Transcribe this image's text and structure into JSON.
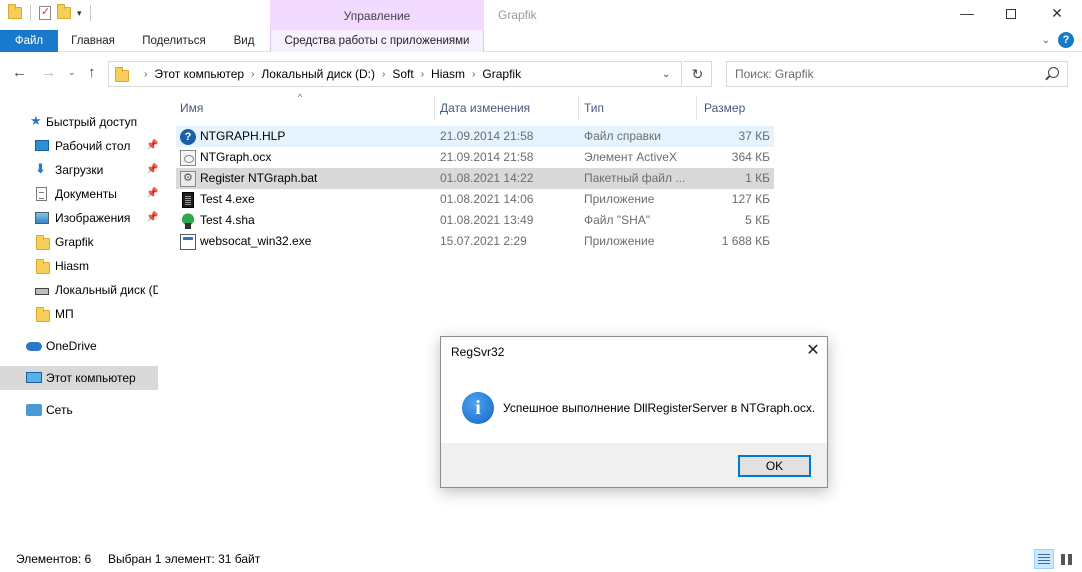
{
  "window": {
    "title": "Grapfik",
    "context_group": "Управление",
    "controls": {
      "minimize": "—",
      "close": "✕"
    }
  },
  "ribbon": {
    "tabs": [
      {
        "label": "Файл"
      },
      {
        "label": "Главная"
      },
      {
        "label": "Поделиться"
      },
      {
        "label": "Вид"
      },
      {
        "label": "Средства работы с приложениями"
      }
    ],
    "help": "?"
  },
  "address": {
    "crumbs": [
      "Этот компьютер",
      "Локальный диск (D:)",
      "Soft",
      "Hiasm",
      "Grapfik"
    ]
  },
  "search": {
    "placeholder": "Поиск: Grapfik"
  },
  "nav": {
    "items": [
      {
        "label": "Быстрый доступ",
        "icon": "star-icon"
      },
      {
        "label": "Рабочий стол",
        "icon": "desktop-icon",
        "pinned": true
      },
      {
        "label": "Загрузки",
        "icon": "downloads-icon",
        "pinned": true
      },
      {
        "label": "Документы",
        "icon": "documents-icon",
        "pinned": true
      },
      {
        "label": "Изображения",
        "icon": "pictures-icon",
        "pinned": true
      },
      {
        "label": "Grapfik",
        "icon": "folder-icon"
      },
      {
        "label": "Hiasm",
        "icon": "folder-icon"
      },
      {
        "label": "Локальный диск (D:)",
        "icon": "drive-icon"
      },
      {
        "label": "МП",
        "icon": "folder-icon"
      },
      {
        "label": "OneDrive",
        "icon": "onedrive-icon"
      },
      {
        "label": "Этот компьютер",
        "icon": "computer-icon"
      },
      {
        "label": "Сеть",
        "icon": "network-icon"
      }
    ]
  },
  "files": {
    "columns": [
      "Имя",
      "Дата изменения",
      "Тип",
      "Размер"
    ],
    "rows": [
      {
        "name": "NTGRAPH.HLP",
        "date": "21.09.2014 21:58",
        "type": "Файл справки",
        "size": "37 КБ",
        "icon": "help-file-icon"
      },
      {
        "name": "NTGraph.ocx",
        "date": "21.09.2014 21:58",
        "type": "Элемент ActiveX",
        "size": "364 КБ",
        "icon": "activex-file-icon"
      },
      {
        "name": "Register NTGraph.bat",
        "date": "01.08.2021 14:22",
        "type": "Пакетный файл ...",
        "size": "1 КБ",
        "icon": "batch-file-icon"
      },
      {
        "name": "Test 4.exe",
        "date": "01.08.2021 14:06",
        "type": "Приложение",
        "size": "127 КБ",
        "icon": "exe-file-icon"
      },
      {
        "name": "Test 4.sha",
        "date": "01.08.2021 13:49",
        "type": "Файл \"SHA\"",
        "size": "5 КБ",
        "icon": "sha-file-icon"
      },
      {
        "name": "websocat_win32.exe",
        "date": "15.07.2021 2:29",
        "type": "Приложение",
        "size": "1 688 КБ",
        "icon": "app-file-icon"
      }
    ]
  },
  "status": {
    "count": "Элементов: 6",
    "selection": "Выбран 1 элемент: 31 байт"
  },
  "dialog": {
    "title": "RegSvr32",
    "message": "Успешное выполнение DllRegisterServer в NTGraph.ocx.",
    "ok": "OK",
    "close": "✕"
  }
}
